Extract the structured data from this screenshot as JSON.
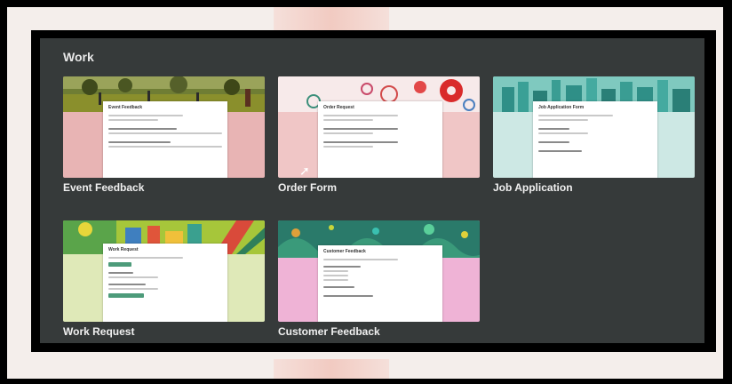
{
  "section": {
    "title": "Work"
  },
  "templates": [
    {
      "label": "Event Feedback",
      "doc_title": "Event Feedback",
      "bg": "#e8b4b4",
      "header": "#7a8b3a"
    },
    {
      "label": "Order Form",
      "doc_title": "Order Request",
      "bg": "#f0c6c6",
      "header": "#f5e6e6"
    },
    {
      "label": "Job Application",
      "doc_title": "Job Application Form",
      "bg": "#cde8e4",
      "header": "#2f8f87"
    },
    {
      "label": "Work Request",
      "doc_title": "Work Request",
      "bg": "#dfe9b8",
      "header": "#4d8f3a"
    },
    {
      "label": "Customer Feedback",
      "doc_title": "Customer Feedback",
      "bg": "#efb3d6",
      "header": "#2a7a6a"
    }
  ]
}
